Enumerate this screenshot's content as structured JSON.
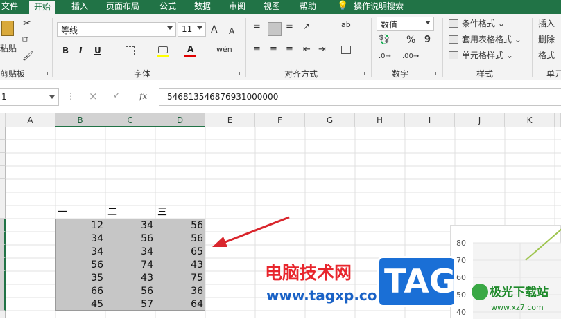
{
  "ribbon_tabs": [
    "文件",
    "开始",
    "插入",
    "页面布局",
    "公式",
    "数据",
    "审阅",
    "视图",
    "帮助",
    "操作说明搜索"
  ],
  "clipboard": {
    "paste": "粘贴",
    "group": "剪贴板"
  },
  "font": {
    "name": "等线",
    "size": "11",
    "grow": "A",
    "shrink": "A",
    "bold": "B",
    "italic": "I",
    "underline": "U",
    "font_color": "A",
    "phonetic": "wén",
    "group": "字体"
  },
  "alignment": {
    "group": "对齐方式",
    "wrap": "ab"
  },
  "number": {
    "format": "数值",
    "percent": "%",
    "comma": "9",
    "group": "数字"
  },
  "styles": {
    "conditional": "条件格式",
    "table": "套用表格格式",
    "cell": "单元格样式",
    "group": "样式"
  },
  "cells": {
    "insert": "插入",
    "delete": "删除",
    "format": "格式",
    "group": "单元"
  },
  "formula_bar": {
    "name_box": "1",
    "cancel": "×",
    "enter": "✓",
    "fx": "fx",
    "content": "546813546876931000000"
  },
  "columns": [
    "A",
    "B",
    "C",
    "D",
    "E",
    "F",
    "G",
    "H",
    "I",
    "J",
    "K"
  ],
  "table": {
    "headers": [
      "一",
      "二",
      "三"
    ],
    "rows": [
      [
        "12",
        "34",
        "56"
      ],
      [
        "34",
        "56",
        "56"
      ],
      [
        "34",
        "34",
        "65"
      ],
      [
        "56",
        "74",
        "43"
      ],
      [
        "35",
        "43",
        "75"
      ],
      [
        "66",
        "56",
        "36"
      ],
      [
        "45",
        "57",
        "64"
      ]
    ]
  },
  "chart_data": {
    "type": "line",
    "y_ticks": [
      "80",
      "70",
      "60",
      "50",
      "40"
    ],
    "ylim": [
      40,
      80
    ]
  },
  "watermark": {
    "text": "电脑技术网",
    "url": "www.tagxp.com",
    "badge": "TAG",
    "site2": "极光下载站",
    "url2": "www.xz7.com"
  },
  "colors": {
    "accent": "#217346",
    "selection": "#c6c6c6",
    "arrow": "#d9262d",
    "watermark_red": "#e8262d",
    "watermark_blue": "#1a62c6"
  }
}
